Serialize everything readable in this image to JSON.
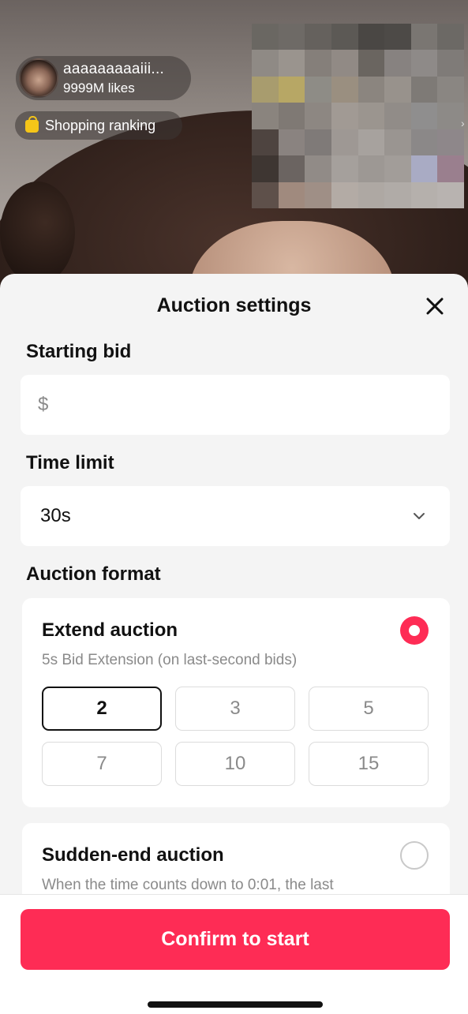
{
  "live": {
    "host_name": "aaaaaaaaaiii...",
    "likes": "9999M likes",
    "ranking_label": "Shopping ranking",
    "mosaic_colors": [
      "#6a6762",
      "#6e6a66",
      "#65615d",
      "#5c5955",
      "#4a4744",
      "#4d4a47",
      "#7a7672",
      "#6c6965",
      "#8f8a85",
      "#9a948e",
      "#857f7a",
      "#918a85",
      "#6a6560",
      "#878280",
      "#8e8a88",
      "#7f7b78",
      "#a89c6e",
      "#b7a765",
      "#8e8c86",
      "#9a8f80",
      "#8b857f",
      "#98928c",
      "#7e7a76",
      "#8a8682",
      "#8a847e",
      "#7f7974",
      "#8d8782",
      "#a19a94",
      "#9b958f",
      "#918c88",
      "#8f8e8e",
      "#8d8a87",
      "#4e4440",
      "#8a8380",
      "#7f7a78",
      "#9e9894",
      "#a7a29e",
      "#9a9591",
      "#8b8888",
      "#8e878a",
      "#3e3632",
      "#6b6461",
      "#918b87",
      "#a5a09c",
      "#9d9894",
      "#a29d99",
      "#a9abc4",
      "#9a7f8e",
      "#5e504a",
      "#a08a7e",
      "#9f8f86",
      "#b3aba5",
      "#aea8a3",
      "#b0aba7",
      "#b5b0ac",
      "#b8b3b0"
    ]
  },
  "sheet": {
    "title": "Auction settings",
    "starting_bid": {
      "label": "Starting bid",
      "prefix": "$",
      "value": ""
    },
    "time_limit": {
      "label": "Time limit",
      "value": "30s"
    },
    "auction_format": {
      "label": "Auction format",
      "extend": {
        "title": "Extend auction",
        "description": "5s Bid Extension (on last-second bids)",
        "selected": true,
        "options": [
          "2",
          "3",
          "5",
          "7",
          "10",
          "15"
        ],
        "selected_option": "2"
      },
      "sudden_end": {
        "title": "Sudden-end auction",
        "description": "When the time counts down to 0:01, the last",
        "selected": false
      }
    },
    "confirm_label": "Confirm to start"
  },
  "colors": {
    "accent": "#fe2c55",
    "sheet_bg": "#f4f4f4",
    "muted_text": "#8a8a8a"
  }
}
